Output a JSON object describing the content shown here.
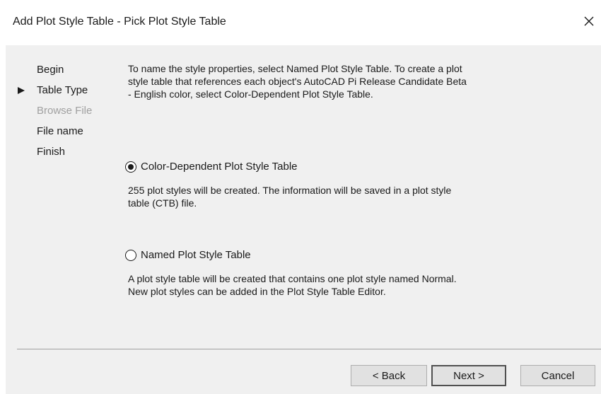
{
  "window": {
    "title": "Add Plot Style Table - Pick Plot Style Table",
    "close_glyph": "✕"
  },
  "steps": [
    {
      "label": "Begin",
      "state": "normal"
    },
    {
      "label": "Table Type",
      "state": "current"
    },
    {
      "label": "Browse File",
      "state": "disabled"
    },
    {
      "label": "File name",
      "state": "normal"
    },
    {
      "label": "Finish",
      "state": "normal"
    }
  ],
  "content": {
    "intro": "To name the style properties, select Named Plot Style Table. To create a plot style table that references each object's AutoCAD Pi Release Candidate Beta - English color, select Color-Dependent Plot Style Table.",
    "options": [
      {
        "label": "Color-Dependent Plot Style Table",
        "selected": true,
        "description": "255 plot styles will be created. The information will be saved in a plot style table (CTB) file."
      },
      {
        "label": "Named Plot Style Table",
        "selected": false,
        "description": "A plot style table will be created that contains one plot style named Normal.  New plot styles can be added in the Plot Style Table Editor."
      }
    ]
  },
  "buttons": {
    "back": "< Back",
    "next": "Next >",
    "cancel": "Cancel"
  },
  "colors": {
    "dialog_bg": "#f0f0f0",
    "title_bg": "#ffffff",
    "disabled_text": "#a0a0a0",
    "button_bg": "#e1e1e1"
  },
  "icons": {
    "close": "close-icon",
    "current_step": "triangle-right-icon"
  }
}
